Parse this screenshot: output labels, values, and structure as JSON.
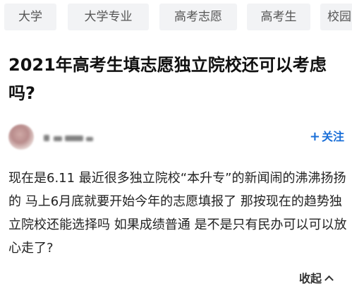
{
  "tags": [
    "大学",
    "大学专业",
    "高考志愿",
    "高考生",
    "校园"
  ],
  "question": {
    "title": "2021年高考生填志愿独立院校还可以考虑吗?",
    "body": "现在是6.11 最近很多独立院校“本升专”的新闻闹的沸沸扬扬的 马上6月底就要开始今年的志愿填报了 那按现在的趋势独立院校还能选择吗 如果成绩普通 是不是只有民办可以可以放心走了?"
  },
  "follow_label": "关注",
  "follow_icon": "plus-icon",
  "collapse_label": "收起",
  "colors": {
    "accent": "#1a6fd8",
    "tag_bg": "#f2f3f5"
  }
}
